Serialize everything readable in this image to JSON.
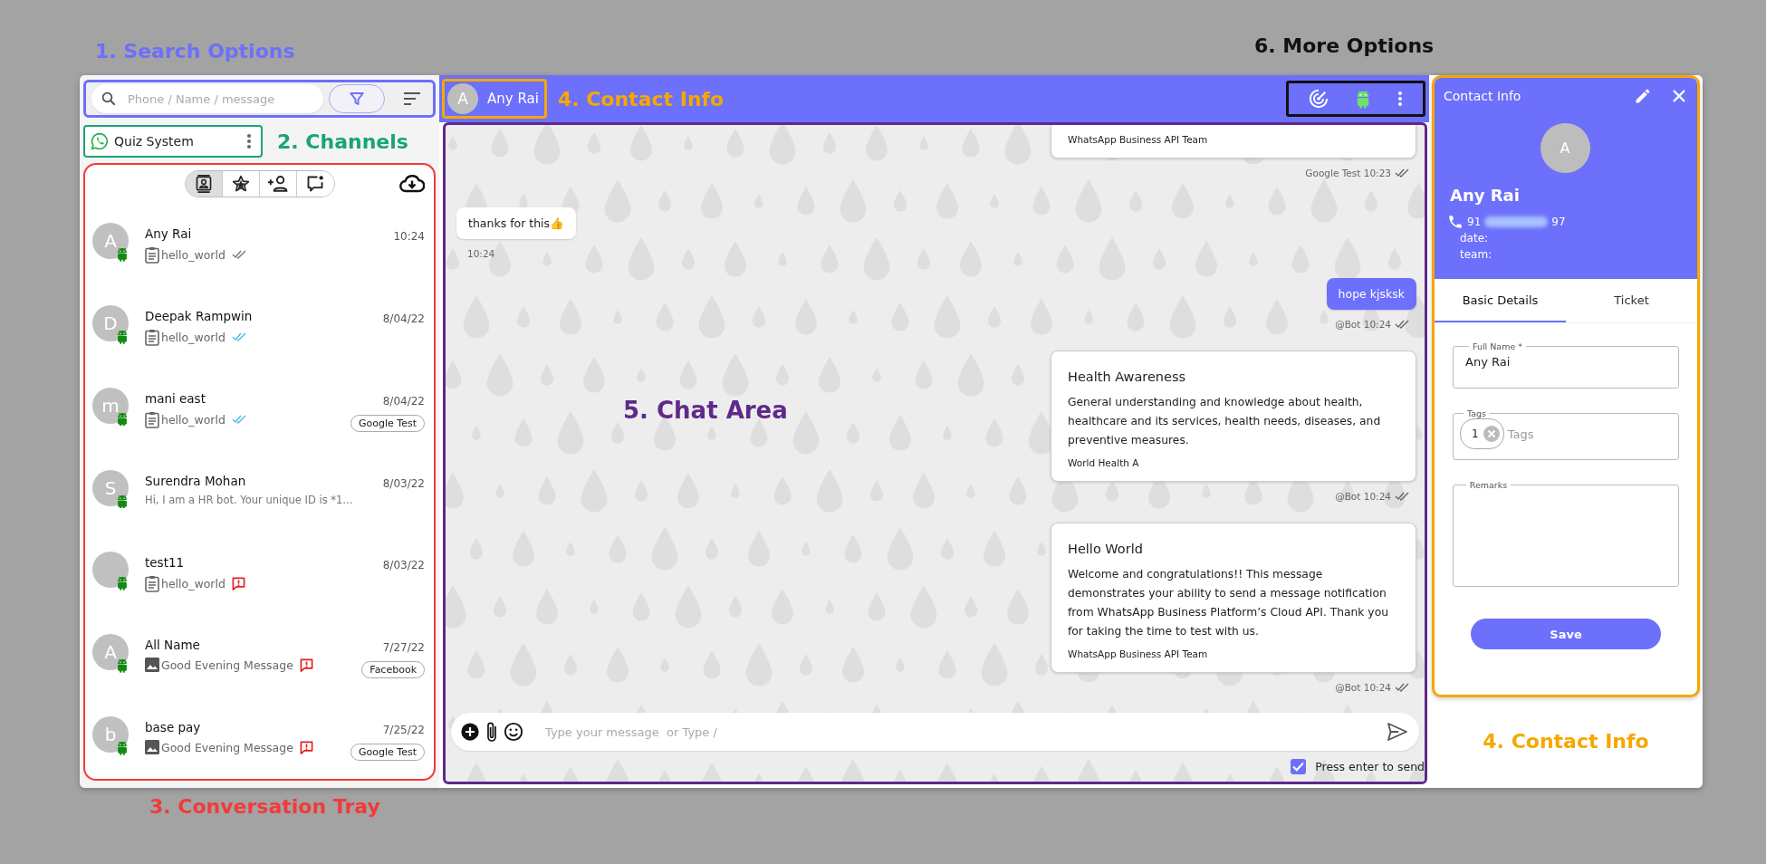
{
  "search": {
    "placeholder": "Phone / Name / message",
    "callout": {
      "label": "1. Search Options",
      "color": "#6c70fb"
    }
  },
  "channel": {
    "name": "Quiz System",
    "callout": {
      "label": "2. Channels",
      "color": "#1aa37a"
    }
  },
  "tray": {
    "callout": {
      "label": "3. Conversation Tray",
      "color": "#f23a3a"
    },
    "tabs": [
      {
        "kind": "contacts",
        "selected": true
      },
      {
        "kind": "starred",
        "selected": false
      },
      {
        "kind": "add-contact",
        "selected": false
      },
      {
        "kind": "unread",
        "selected": false
      }
    ],
    "conversations": [
      {
        "kind": "template",
        "avatar": "A",
        "name": "Any Rai",
        "preview": "hello_world",
        "ticks": true,
        "read": false,
        "failed": false,
        "time": "10:24"
      },
      {
        "kind": "template",
        "avatar": "D",
        "name": "Deepak Rampwin",
        "preview": "hello_world",
        "ticks": true,
        "read": true,
        "failed": false,
        "time": "8/04/22"
      },
      {
        "kind": "template",
        "avatar": "m",
        "name": "mani east",
        "preview": "hello_world",
        "ticks": true,
        "read": true,
        "failed": false,
        "time": "8/04/22",
        "tag": "Google Test"
      },
      {
        "kind": "text",
        "avatar": "S",
        "name": "Surendra Mohan",
        "preview": "Hi, I am a HR bot. Your unique ID is *1…",
        "ticks": false,
        "failed": false,
        "time": "8/03/22"
      },
      {
        "kind": "template",
        "name": "test11",
        "preview": "hello_world",
        "ticks": false,
        "failed": true,
        "time": "8/03/22"
      },
      {
        "kind": "image",
        "avatar": "A",
        "name": "All Name",
        "preview": "Good Evening Message",
        "ticks": false,
        "failed": true,
        "time": "7/27/22",
        "tag": "Facebook"
      },
      {
        "kind": "image",
        "avatar": "b",
        "name": "base pay",
        "preview": "Good Evening Message",
        "ticks": false,
        "failed": true,
        "time": "7/25/22",
        "tag": "Google Test"
      }
    ]
  },
  "chat_header": {
    "avatar": "A",
    "name": "Any Rai",
    "callout": {
      "label": "4. Contact Info",
      "color": "#f5a800"
    },
    "options_callout": {
      "label": "6. More Options",
      "color": "#111111"
    }
  },
  "chat": {
    "callout": {
      "label": "5. Chat Area",
      "color": "#5e2a8a"
    },
    "messages": [
      {
        "kind": "card",
        "outgoing": true,
        "footer": "WhatsApp Business API Team",
        "meta": "Google Test 10:23",
        "ticks": true
      },
      {
        "kind": "text",
        "outgoing": false,
        "text": "thanks for this👍",
        "meta": "10:24",
        "ticks": false
      },
      {
        "kind": "text",
        "outgoing": true,
        "text": "hope kjsksk",
        "meta": "@Bot 10:24",
        "ticks": true
      },
      {
        "kind": "card",
        "outgoing": true,
        "title": "Health Awareness",
        "text": "General understanding and knowledge about health, healthcare and its services, health needs, diseases, and preventive measures.",
        "footer": "World Health A",
        "meta": "@Bot 10:24",
        "ticks": true
      },
      {
        "kind": "card",
        "outgoing": true,
        "title": "Hello World",
        "text": "Welcome and congratulations!! This message demonstrates your ability to send a message notification from WhatsApp Business Platform’s Cloud API. Thank you for taking the time to test with us.",
        "footer": "WhatsApp Business API Team",
        "meta": "@Bot 10:24",
        "ticks": true
      }
    ],
    "composer": {
      "placeholder": "Type your message  or Type /"
    },
    "enter_to_send": {
      "label": "Press enter to send",
      "checked": true
    }
  },
  "contact_info": {
    "title": "Contact Info",
    "avatar": "A",
    "name": "Any Rai",
    "phone_start": "91",
    "phone_end": "97",
    "details": [
      "date:",
      "team:"
    ],
    "tabs": [
      {
        "label": "Basic Details",
        "selected": true
      },
      {
        "label": "Ticket",
        "selected": false
      }
    ],
    "full_name": {
      "label": "Full Name *",
      "value": "Any Rai"
    },
    "tags": {
      "label": "Tags",
      "chips": [
        "1"
      ],
      "placeholder": "Tags"
    },
    "remarks": {
      "label": "Remarks"
    },
    "save": "Save",
    "callout": {
      "label": "4. Contact Info",
      "color": "#f5a800"
    }
  }
}
